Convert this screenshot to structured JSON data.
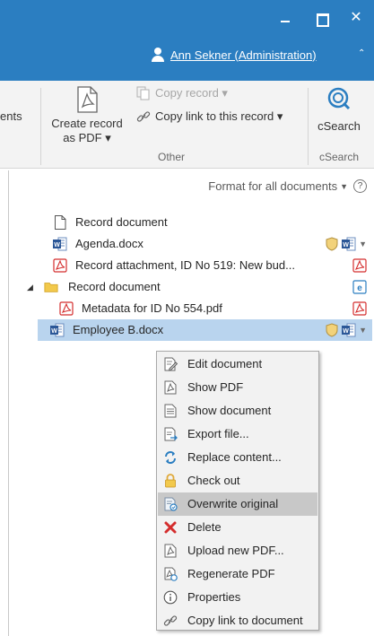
{
  "titlebar": {
    "user_name": "Ann Sekner (Administration)",
    "minimize_glyph": "",
    "maximize_glyph": "",
    "close_glyph": "✕",
    "collapse_glyph": "⌃"
  },
  "ribbon": {
    "partial_label": "ents",
    "create_record_pdf_line1": "Create record",
    "create_record_pdf_line2": "as PDF ▾",
    "copy_record": "Copy record ▾",
    "copy_link_record": "Copy link to this record ▾",
    "group_other": "Other",
    "csearch_label": "cSearch",
    "group_csearch": "cSearch"
  },
  "format_bar": {
    "label": "Format for all documents",
    "arrow": "▼",
    "help": "?"
  },
  "tree": [
    {
      "label": "Record document",
      "icon": "blank-document-icon"
    },
    {
      "label": "Agenda.docx",
      "icon": "word-document-icon"
    },
    {
      "label": "Record attachment, ID No 519: New bud...",
      "icon": "pdf-icon"
    },
    {
      "label": "Record document",
      "icon": "folder-icon",
      "expander": "◢"
    },
    {
      "label": "Metadata for ID No 554.pdf",
      "icon": "pdf-icon"
    },
    {
      "label": "Employee B.docx",
      "icon": "word-document-icon"
    }
  ],
  "tree_dd_arrow": "▼",
  "context_menu": [
    {
      "label": "Edit document",
      "icon": "edit-document-icon"
    },
    {
      "label": "Show PDF",
      "icon": "pdf-outline-icon"
    },
    {
      "label": "Show document",
      "icon": "document-icon"
    },
    {
      "label": "Export file...",
      "icon": "export-icon"
    },
    {
      "label": "Replace content...",
      "icon": "replace-icon"
    },
    {
      "label": "Check out",
      "icon": "lock-icon"
    },
    {
      "label": "Overwrite original",
      "icon": "overwrite-icon"
    },
    {
      "label": "Delete",
      "icon": "delete-x-icon"
    },
    {
      "label": "Upload new PDF...",
      "icon": "upload-pdf-icon"
    },
    {
      "label": "Regenerate PDF",
      "icon": "regenerate-pdf-icon"
    },
    {
      "label": "Properties",
      "icon": "info-icon"
    },
    {
      "label": "Copy link to document",
      "icon": "link-icon"
    }
  ],
  "colors": {
    "titlebar": "#2b7ec1",
    "selection": "#b9d4ee",
    "pdf_red": "#d42d2d",
    "word_blue": "#2b5797",
    "folder_yellow": "#f2c94c"
  }
}
